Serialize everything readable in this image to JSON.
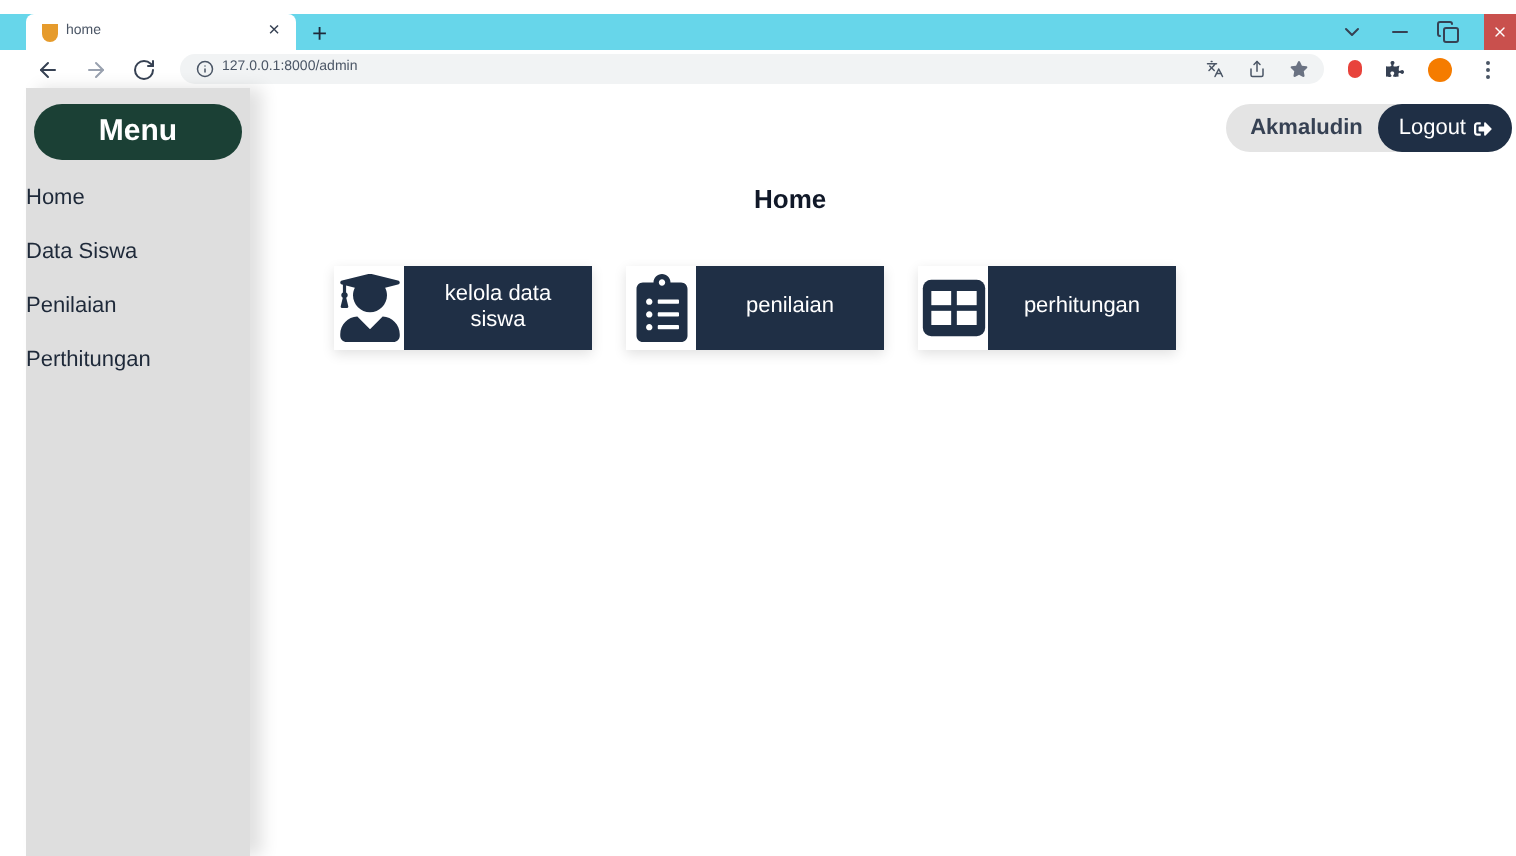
{
  "browser": {
    "tab_title": "home",
    "tab_close": "×",
    "new_tab": "+",
    "url": "127.0.0.1:8000/admin"
  },
  "sidebar": {
    "title": "Menu",
    "items": [
      {
        "label": "Home"
      },
      {
        "label": "Data Siswa"
      },
      {
        "label": "Penilaian"
      },
      {
        "label": "Perthitungan"
      }
    ]
  },
  "header": {
    "user": "Akmaludin",
    "logout": "Logout"
  },
  "page_title": "Home",
  "cards": [
    {
      "kind": "student",
      "label": "kelola data siswa"
    },
    {
      "kind": "clipboard",
      "label": "penilaian"
    },
    {
      "kind": "table",
      "label": "perhitungan"
    }
  ]
}
